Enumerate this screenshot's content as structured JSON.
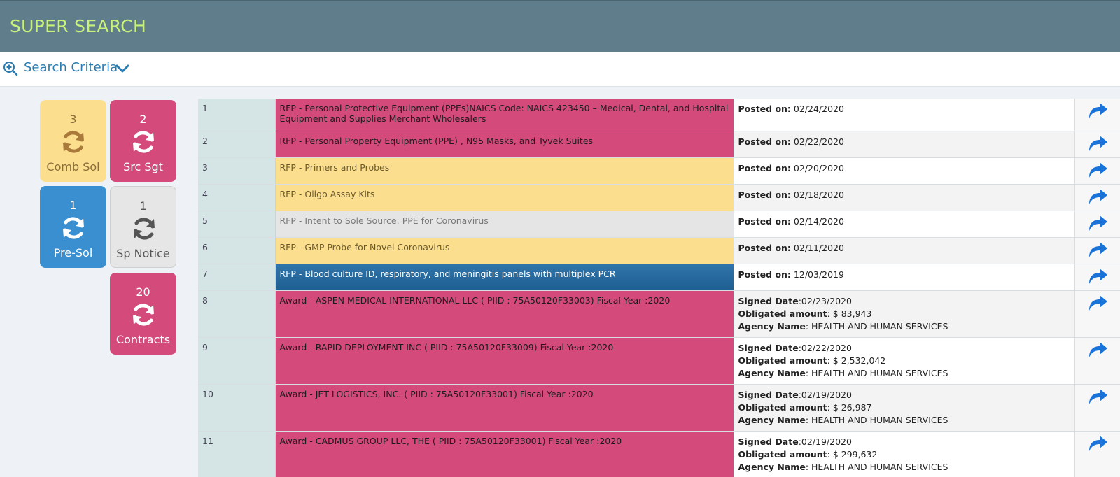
{
  "header": {
    "title": "SUPER SEARCH"
  },
  "criteria": {
    "label": "Search Criteria"
  },
  "tiles": [
    {
      "count": "3",
      "label": "Comb Sol",
      "bg": "#fbdf8f",
      "fg": "#8a6d3b",
      "iconColor": "#a97a3a"
    },
    {
      "count": "2",
      "label": "Src Sgt",
      "bg": "#d44a7b",
      "fg": "#ffffff",
      "iconColor": "#ffffff"
    },
    {
      "count": "1",
      "label": "Pre-Sol",
      "bg": "#3a8fd0",
      "fg": "#ffffff",
      "iconColor": "#ffffff"
    },
    {
      "count": "1",
      "label": "Sp Notice",
      "bg": "#e6e6e6",
      "fg": "#555555",
      "iconColor": "#555555"
    },
    {
      "count": "20",
      "label": "Contracts",
      "bg": "#d44a7b",
      "fg": "#ffffff",
      "iconColor": "#ffffff"
    }
  ],
  "rows": [
    {
      "num": "1",
      "color": "pink",
      "title": "RFP - Personal Protective Equipment (PPEs)NAICS Code: NAICS 423450 – Medical, Dental, and Hospital Equipment and Supplies Merchant Wholesalers",
      "info": [
        {
          "label": "Posted on:",
          "value": " 02/24/2020"
        }
      ]
    },
    {
      "num": "2",
      "color": "pink",
      "title": "RFP - Personal Property Equipment (PPE) , N95 Masks, and Tyvek Suites",
      "info": [
        {
          "label": "Posted on:",
          "value": " 02/22/2020"
        }
      ]
    },
    {
      "num": "3",
      "color": "yellow",
      "title": "RFP - Primers and Probes",
      "info": [
        {
          "label": "Posted on:",
          "value": " 02/20/2020"
        }
      ]
    },
    {
      "num": "4",
      "color": "yellow",
      "title": "RFP - Oligo Assay Kits",
      "info": [
        {
          "label": "Posted on:",
          "value": " 02/18/2020"
        }
      ]
    },
    {
      "num": "5",
      "color": "gray",
      "title": "RFP - Intent to Sole Source: PPE for Coronavirus",
      "info": [
        {
          "label": "Posted on:",
          "value": " 02/14/2020"
        }
      ]
    },
    {
      "num": "6",
      "color": "yellow",
      "title": "RFP - GMP Probe for Novel Coronavirus",
      "info": [
        {
          "label": "Posted on:",
          "value": " 02/11/2020"
        }
      ]
    },
    {
      "num": "7",
      "color": "blue",
      "title": "RFP - Blood culture ID, respiratory, and meningitis panels with multiplex PCR",
      "info": [
        {
          "label": "Posted on:",
          "value": " 12/03/2019"
        }
      ]
    },
    {
      "num": "8",
      "color": "pink",
      "title": "Award - ASPEN MEDICAL INTERNATIONAL LLC ( PIID : 75A50120F33003) Fiscal Year :2020",
      "info": [
        {
          "label": "Signed Date",
          "value": ":02/23/2020"
        },
        {
          "label": "Obligated amount",
          "value": ": $ 83,943"
        },
        {
          "label": "Agency Name",
          "value": ": HEALTH AND HUMAN SERVICES"
        }
      ]
    },
    {
      "num": "9",
      "color": "pink",
      "title": "Award - RAPID DEPLOYMENT INC ( PIID : 75A50120F33009) Fiscal Year :2020",
      "info": [
        {
          "label": "Signed Date",
          "value": ":02/22/2020"
        },
        {
          "label": "Obligated amount",
          "value": ": $ 2,532,042"
        },
        {
          "label": "Agency Name",
          "value": ": HEALTH AND HUMAN SERVICES"
        }
      ]
    },
    {
      "num": "10",
      "color": "pink",
      "title": "Award - JET LOGISTICS, INC. ( PIID : 75A50120F33001) Fiscal Year :2020",
      "info": [
        {
          "label": "Signed Date",
          "value": ":02/19/2020"
        },
        {
          "label": "Obligated amount",
          "value": ": $ 26,987"
        },
        {
          "label": "Agency Name",
          "value": ": HEALTH AND HUMAN SERVICES"
        }
      ]
    },
    {
      "num": "11",
      "color": "pink",
      "title": "Award - CADMUS GROUP LLC, THE ( PIID : 75A50120F33001) Fiscal Year :2020",
      "info": [
        {
          "label": "Signed Date",
          "value": ":02/19/2020"
        },
        {
          "label": "Obligated amount",
          "value": ": $ 299,632"
        },
        {
          "label": "Agency Name",
          "value": ": HEALTH AND HUMAN SERVICES"
        }
      ]
    },
    {
      "num": "",
      "color": "pink",
      "title": "",
      "info": []
    }
  ]
}
